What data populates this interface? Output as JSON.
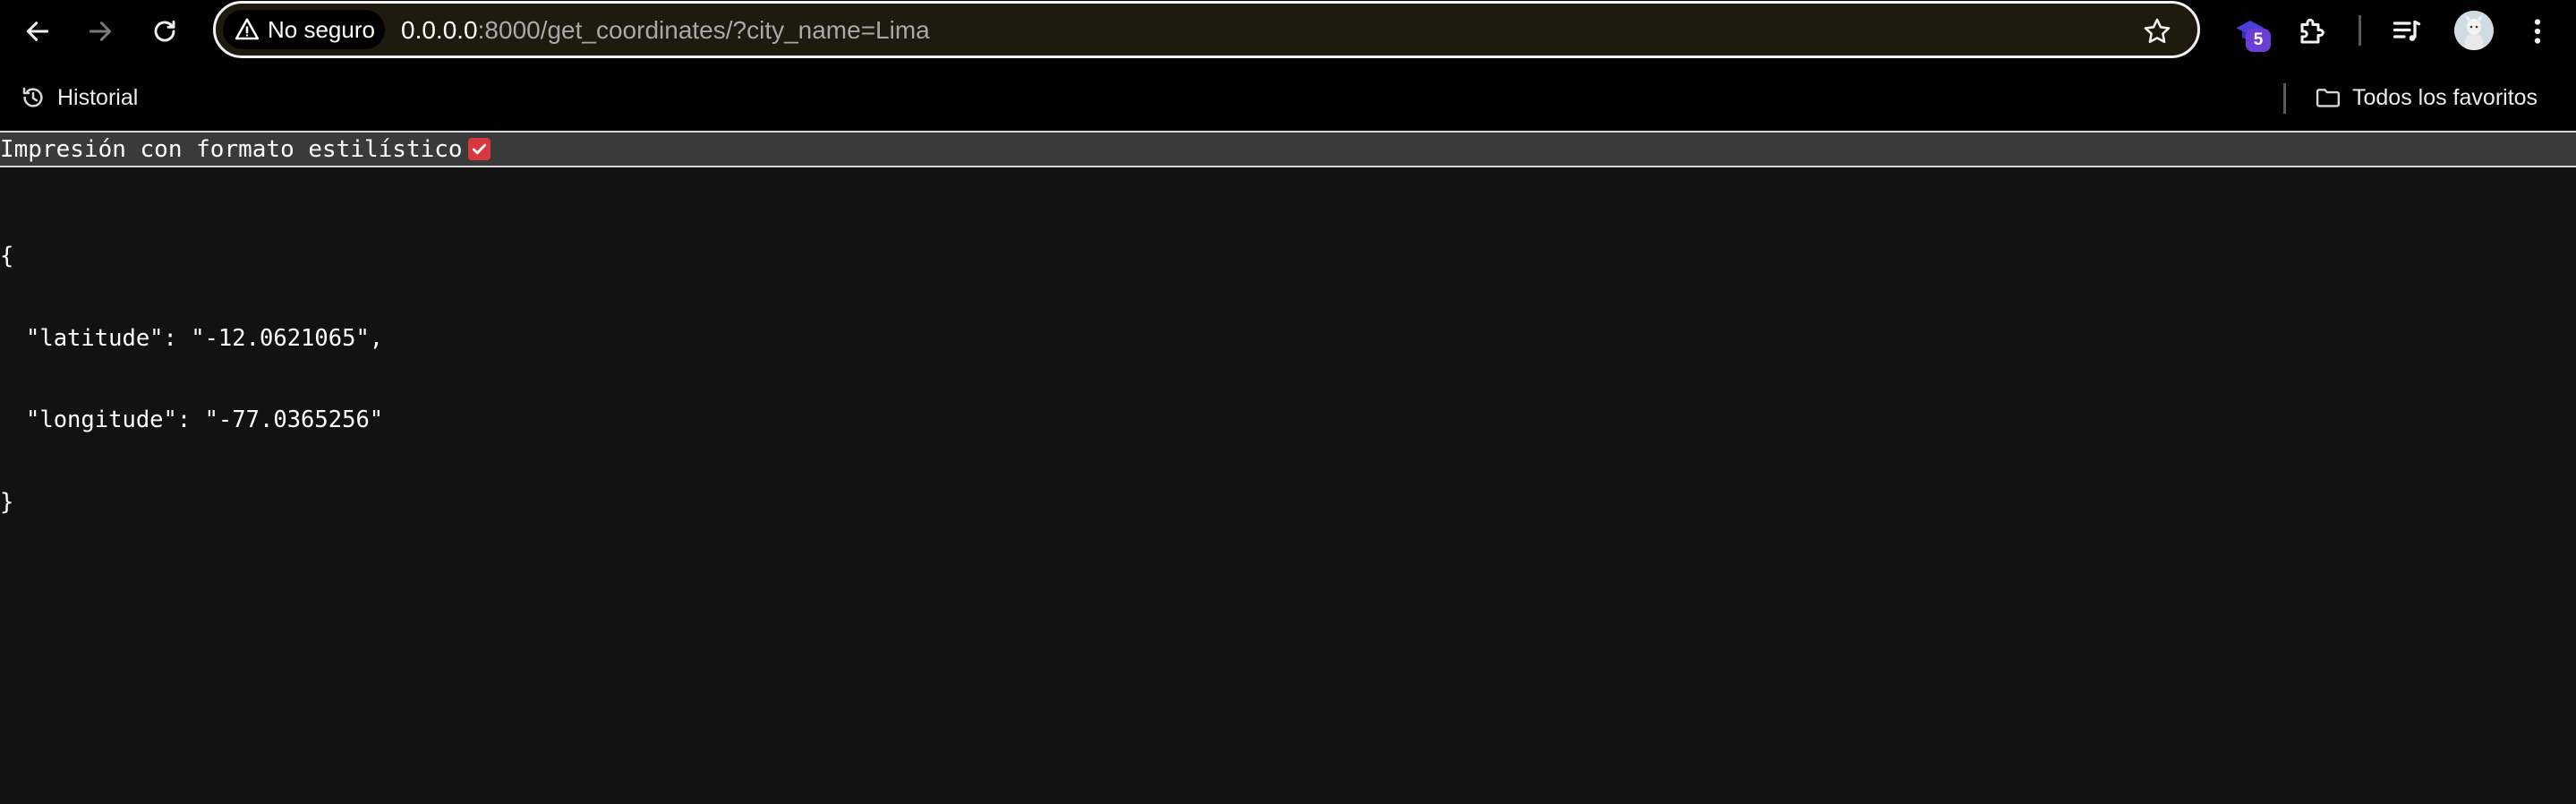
{
  "toolbar": {
    "security_label": "No seguro",
    "url_host": "0.0.0.0",
    "url_rest": ":8000/get_coordinates/?city_name=Lima",
    "extension_badge_count": "5",
    "icons": {
      "back": "arrow-left-icon",
      "forward": "arrow-right-icon",
      "reload": "reload-icon",
      "security": "warning-triangle-icon",
      "bookmark": "star-icon",
      "extension": "graduation-cap-icon",
      "extensions_menu": "puzzle-icon",
      "media": "media-playlist-icon",
      "menu": "kebab-menu-icon"
    }
  },
  "bookmarks": {
    "history_label": "Historial",
    "favorites_label": "Todos los favoritos"
  },
  "page": {
    "pretty_print_label": "Impresión con formato estilístico",
    "pretty_print_checked": true,
    "json_open": "{",
    "latitude_line": "\"latitude\": \"-12.0621065\",",
    "longitude_line": "\"longitude\": \"-77.0365256\"",
    "json_close": "}"
  },
  "colors": {
    "page_bg": "#121212",
    "chrome_bg": "#000000",
    "omnibox_bg": "#1f1a0e",
    "checkbox": "#d9373f",
    "badge": "#6b3fd6"
  }
}
